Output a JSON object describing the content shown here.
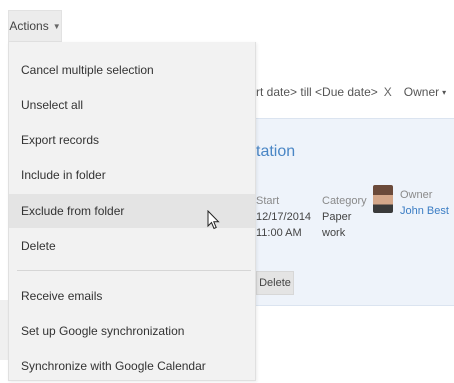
{
  "actions_button": {
    "label": "Actions",
    "caret": "▼"
  },
  "menu": {
    "items": [
      {
        "label": "Cancel multiple selection"
      },
      {
        "label": "Unselect all"
      },
      {
        "label": "Export records"
      },
      {
        "label": "Include in folder"
      },
      {
        "label": "Exclude from folder"
      },
      {
        "label": "Delete"
      },
      {
        "label": "Receive emails"
      },
      {
        "label": "Set up Google synchronization"
      },
      {
        "label": "Synchronize with Google Calendar"
      }
    ]
  },
  "filter": {
    "date_text": "rt date> till <Due date>",
    "clear": "X",
    "owner_label": "Owner",
    "owner_caret": "▾",
    "tail": "\\"
  },
  "card": {
    "title": "tation",
    "start_label": "Start",
    "start_date": "12/17/2014",
    "start_time": "11:00 AM",
    "category_label": "Category",
    "category_value_1": "Paper",
    "category_value_2": "work",
    "owner_label": "Owner",
    "owner_name": "John Best",
    "delete_label": "Delete"
  },
  "colors": {
    "accent": "#4a86c5",
    "card_bg": "#eef3fa",
    "menu_bg": "#f2f2f2",
    "menu_hover": "#e4e4e4"
  }
}
